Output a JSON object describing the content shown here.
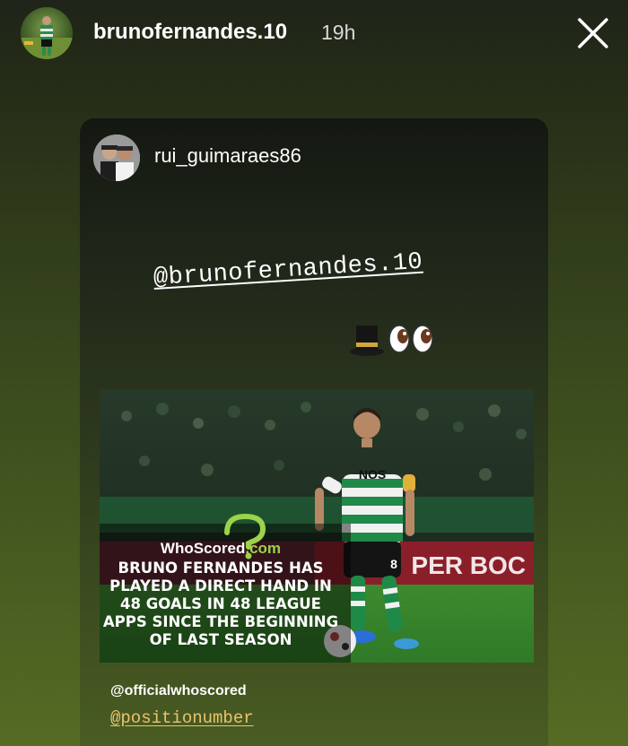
{
  "header": {
    "username": "brunofernandes.10",
    "time_ago": "19h",
    "avatar_icon": "profile-avatar-icon",
    "close_icon": "close-icon"
  },
  "reshared_post": {
    "username": "rui_guimaraes86",
    "avatar_icon": "profile-avatar-icon",
    "mention_sticker": "@brunofernandes.10",
    "emojis": [
      "top-hat-emoji",
      "eyes-emoji"
    ],
    "image": {
      "brand": "WhoScored",
      "brand_suffix": ".com",
      "headline_lines": [
        "BRUNO FERNANDES HAS",
        "PLAYED A DIRECT HAND IN",
        "48 GOALS IN 48 LEAGUE",
        "APPS SINCE THE BEGINNING",
        "OF LAST SEASON"
      ],
      "shirt_text": "NOS",
      "shorts_number": "8",
      "board_text": "PER BOC"
    },
    "caption_line1": "@officialwhoscored",
    "caption_line2": "@positionumber"
  },
  "colors": {
    "brand_green": "#9bd34a",
    "mention_yellow": "#e9c46a"
  }
}
